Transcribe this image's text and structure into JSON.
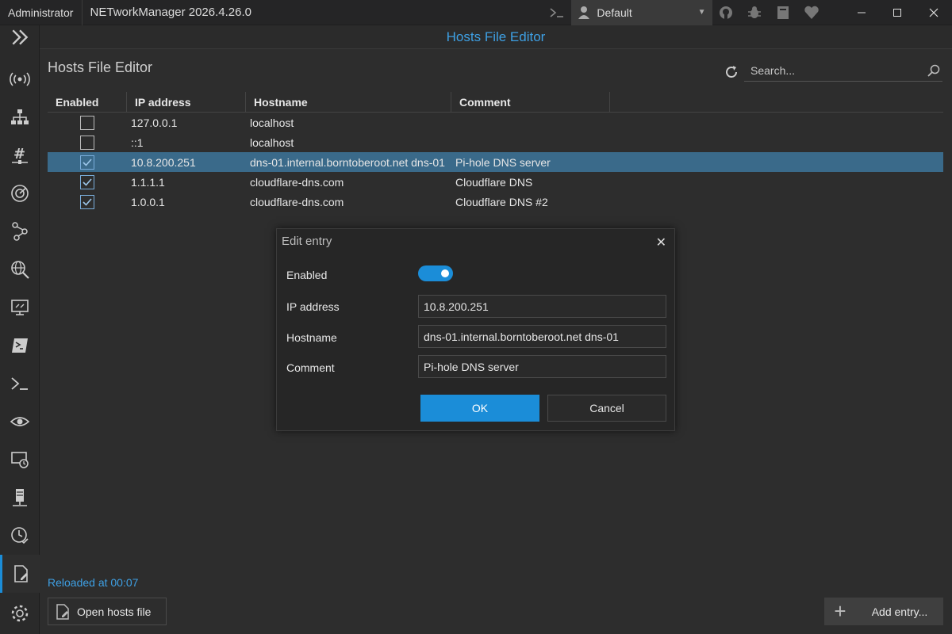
{
  "titlebar": {
    "role": "Administrator",
    "app_title": "NETworkManager 2026.4.26.0",
    "profile": "Default"
  },
  "header": {
    "title": "Hosts File Editor"
  },
  "main": {
    "section_title": "Hosts File Editor",
    "search_placeholder": "Search...",
    "columns": [
      "Enabled",
      "IP address",
      "Hostname",
      "Comment"
    ],
    "rows": [
      {
        "enabled": false,
        "ip": "127.0.0.1",
        "hostname": "localhost",
        "comment": ""
      },
      {
        "enabled": false,
        "ip": "::1",
        "hostname": "localhost",
        "comment": ""
      },
      {
        "enabled": true,
        "ip": "10.8.200.251",
        "hostname": "dns-01.internal.borntoberoot.net dns-01",
        "comment": "Pi-hole DNS server",
        "selected": true
      },
      {
        "enabled": true,
        "ip": "1.1.1.1",
        "hostname": "cloudflare-dns.com",
        "comment": "Cloudflare DNS"
      },
      {
        "enabled": true,
        "ip": "1.0.0.1",
        "hostname": "cloudflare-dns.com",
        "comment": "Cloudflare DNS #2"
      }
    ],
    "status": "Reloaded at 00:07",
    "open_hosts_label": "Open hosts file",
    "add_entry_label": "Add entry..."
  },
  "dialog": {
    "title": "Edit entry",
    "enabled_label": "Enabled",
    "enabled": true,
    "ip_label": "IP address",
    "ip_value": "10.8.200.251",
    "hostname_label": "Hostname",
    "hostname_value": "dns-01.internal.borntoberoot.net dns-01",
    "comment_label": "Comment",
    "comment_value": "Pi-hole DNS server",
    "ok_label": "OK",
    "cancel_label": "Cancel"
  },
  "nav_icons": [
    "expand-icon",
    "wifi-icon",
    "network-icon",
    "ip-scanner-icon",
    "port-scanner-icon",
    "traceroute-icon",
    "dns-lookup-icon",
    "remote-desktop-icon",
    "powershell-icon",
    "terminal-icon",
    "ping-monitor-icon",
    "wake-on-lan-icon",
    "server-icon",
    "history-icon",
    "hosts-file-editor-icon",
    "settings-icon"
  ],
  "colors": {
    "accent": "#1b8dd8",
    "selected_row": "#3a6a8a",
    "background": "#2d2d2d"
  }
}
